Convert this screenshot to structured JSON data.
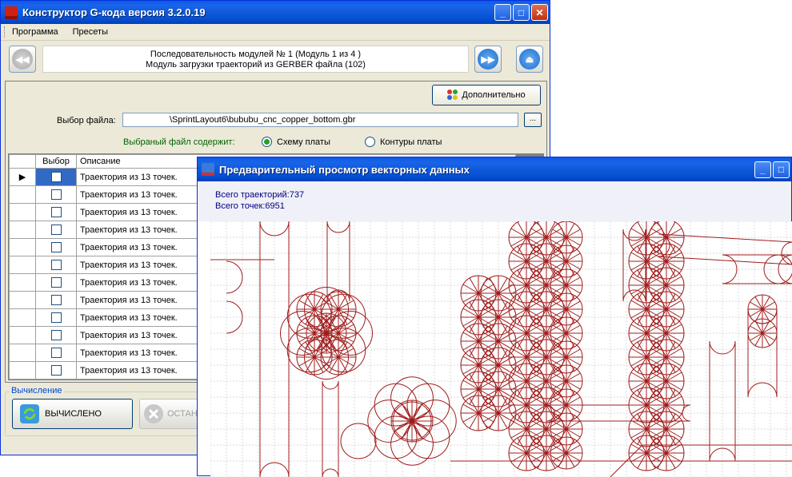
{
  "main_window": {
    "title": "Конструктор G-кода версия 3.2.0.19",
    "menu": [
      "Программа",
      "Пресеты"
    ],
    "nav": {
      "line1": "Последовательность модулей № 1 (Модуль 1 из 4 )",
      "line2": "Модуль загрузки траекторий из GERBER файла (102)"
    },
    "extra_button": "Дополнительно",
    "file_label": "Выбор файла:",
    "file_value": "\\SprintLayout6\\bububu_cnc_copper_bottom.gbr",
    "browse_label": "...",
    "contains_label": "Выбраный файл содержит:",
    "radio_scheme": "Схему платы",
    "radio_contours": "Контуры платы",
    "grid": {
      "headers": [
        "Выбор",
        "Описание"
      ],
      "rows": [
        "Траектория из 13 точек.",
        "Траектория из 13 точек.",
        "Траектория из 13 точек.",
        "Траектория из 13 точек.",
        "Траектория из 13 точек.",
        "Траектория из 13 точек.",
        "Траектория из 13 точек.",
        "Траектория из 13 точек.",
        "Траектория из 13 точек.",
        "Траектория из 13 точек.",
        "Траектория из 13 точек.",
        "Траектория из 13 точек."
      ]
    },
    "calc_legend": "Вычисление",
    "calc_button": "ВЫЧИСЛЕНО",
    "stop_button": "ОСТАН"
  },
  "preview_window": {
    "title": "Предварительный просмотр векторных данных",
    "total_paths": "Всего траекторий:737",
    "total_points": "Всего точек:6951"
  },
  "colors": {
    "trace": "#a01c1c",
    "titlebar": "#0a5ae8"
  }
}
